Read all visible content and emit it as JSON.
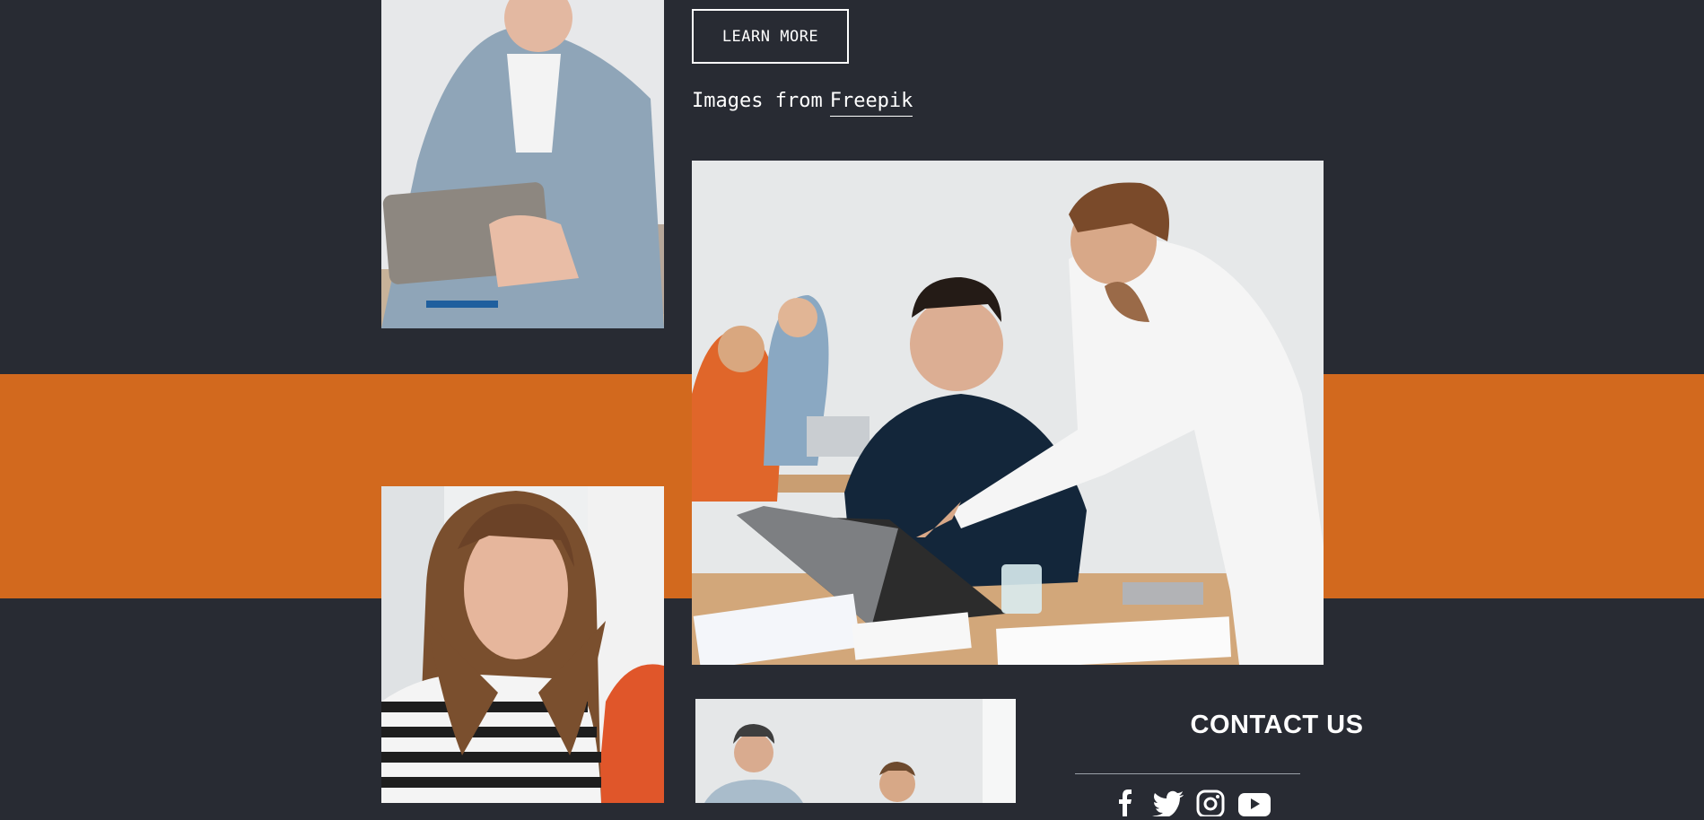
{
  "hero": {
    "learn_more_label": "LEARN MORE",
    "credit_text": "Images from",
    "credit_link": "Freepik"
  },
  "contact": {
    "title": "CONTACT US",
    "social_icons": [
      "facebook-icon",
      "twitter-icon",
      "instagram-icon",
      "youtube-icon"
    ]
  },
  "colors": {
    "background": "#282b33",
    "accent_band": "#d2691e",
    "text": "#ffffff"
  }
}
